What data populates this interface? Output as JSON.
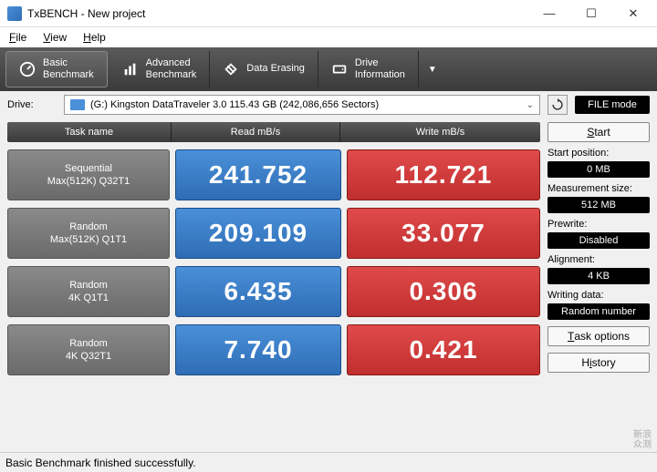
{
  "window": {
    "title": "TxBENCH - New project"
  },
  "menu": {
    "file": "File",
    "view": "View",
    "help": "Help"
  },
  "toolbar": {
    "basic": {
      "l1": "Basic",
      "l2": "Benchmark"
    },
    "advanced": {
      "l1": "Advanced",
      "l2": "Benchmark"
    },
    "erase": "Data Erasing",
    "drive": {
      "l1": "Drive",
      "l2": "Information"
    }
  },
  "drive": {
    "label": "Drive:",
    "value": "(G:) Kingston DataTraveler 3.0  115.43 GB (242,086,656 Sectors)"
  },
  "filemode": "FILE mode",
  "headers": {
    "task": "Task name",
    "read": "Read mB/s",
    "write": "Write mB/s"
  },
  "tests": [
    {
      "name1": "Sequential",
      "name2": "Max(512K) Q32T1",
      "read": "241.752",
      "write": "112.721"
    },
    {
      "name1": "Random",
      "name2": "Max(512K) Q1T1",
      "read": "209.109",
      "write": "33.077"
    },
    {
      "name1": "Random",
      "name2": "4K Q1T1",
      "read": "6.435",
      "write": "0.306"
    },
    {
      "name1": "Random",
      "name2": "4K Q32T1",
      "read": "7.740",
      "write": "0.421"
    }
  ],
  "side": {
    "start": "Start",
    "startpos_l": "Start position:",
    "startpos_v": "0 MB",
    "msize_l": "Measurement size:",
    "msize_v": "512 MB",
    "prewrite_l": "Prewrite:",
    "prewrite_v": "Disabled",
    "align_l": "Alignment:",
    "align_v": "4 KB",
    "wdata_l": "Writing data:",
    "wdata_v": "Random number",
    "taskopt": "Task options",
    "history": "History"
  },
  "status": "Basic Benchmark finished successfully.",
  "watermark": {
    "l1": "新浪",
    "l2": "众测"
  }
}
